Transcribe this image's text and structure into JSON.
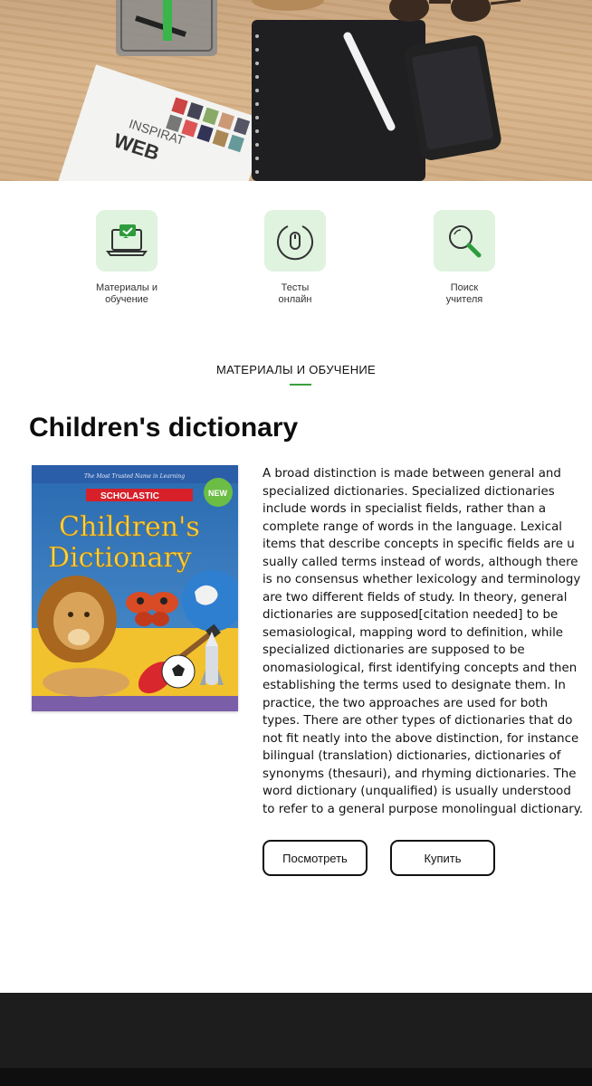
{
  "features": [
    {
      "label_line1": "Материалы и",
      "label_line2": "обучение",
      "icon": "laptop-chat-icon"
    },
    {
      "label_line1": "Тесты",
      "label_line2": "онлайн",
      "icon": "mouse-icon"
    },
    {
      "label_line1": "Поиск",
      "label_line2": "учителя",
      "icon": "magnifier-icon"
    }
  ],
  "section": {
    "title": "МАТЕРИАЛЫ И ОБУЧЕНИЕ"
  },
  "article": {
    "title": "Children's dictionary",
    "book_cover": {
      "tagline": "The Most Trusted Name in Learning",
      "publisher": "SCHOLASTIC",
      "badge": "NEW",
      "title_line1": "Children's",
      "title_line2": "Dictionary"
    },
    "text": "A broad distinction is made between general and specialized dictionaries. Specialized dictionaries include words in specialist fields, rather than a complete range of words in the language. Lexical items that describe concepts in specific fields are u sually called terms instead of words, although there is no consensus whether lexicology and terminology are two different fields of study. In theory, general dictionaries are supposed[citation needed] to be semasiological, mapping word to definition, while specialized dictionaries are supposed to be onomasiological, first identifying concepts and then establishing the terms used to designate them. In practice, the two approaches are used for both types. There are other types of dictionaries that do not fit neatly into the above distinction, for instance bilingual (translation) dictionaries, dictionaries of synonyms (thesauri), and rhyming dictionaries. The word dictionary (unqualified) is usually understood to refer to a general purpose monolingual dictionary.",
    "buttons": {
      "view": "Посмотреть",
      "buy": "Купить"
    }
  },
  "colors": {
    "accent": "#3aa03a",
    "icon_bg": "#dff3df",
    "footer": "#1d1d1d"
  }
}
